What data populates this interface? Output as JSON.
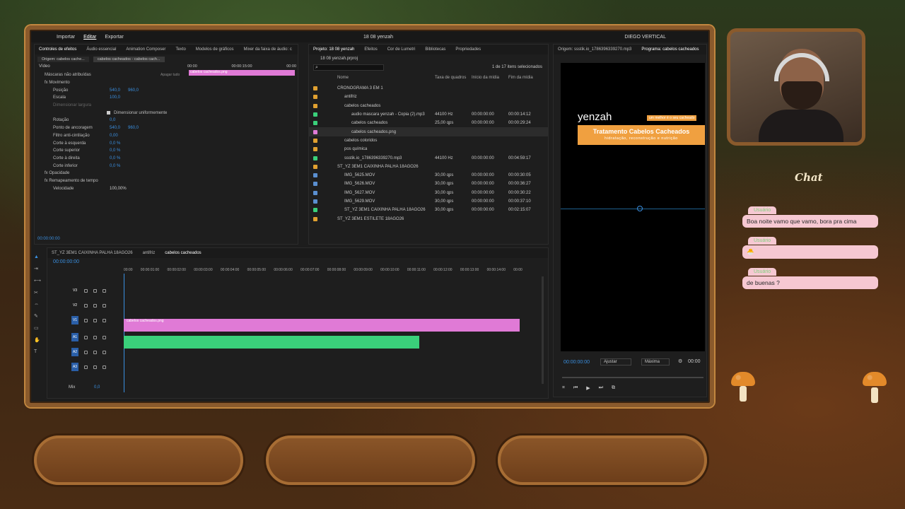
{
  "menu": {
    "items": [
      "Importar",
      "Editar",
      "Exportar"
    ],
    "project_title": "18 08 yenzah",
    "workspace": "DIEGO VERTICAL"
  },
  "effects_panel": {
    "tabs": [
      "Controles de efeitos",
      "Áudio essencial",
      "Animation Composer",
      "Texto",
      "Modelos de gráficos",
      "Mixer da faixa de áudio: c"
    ],
    "source_label": "Origem: cabelos cache...",
    "clip_label": "cabelos cacheados - cabelos cach...",
    "clip_name": "cabelos cacheados.png",
    "section_video": "Vídeo",
    "ruler": [
      "00:00",
      "00:00:15:00",
      "00:00"
    ],
    "rows": [
      {
        "label": "Máscaras não atribuídas",
        "value": "Apagar tudo"
      },
      {
        "label": "fx Movimento",
        "value": ""
      },
      {
        "label": "Posição",
        "value": "540,0",
        "value2": "960,0"
      },
      {
        "label": "Escala",
        "value": "100,0",
        "value2": ""
      },
      {
        "label": "Dimensionar largura",
        "value": "",
        "value2": ""
      },
      {
        "label": "Dimensionar uniformemente",
        "value": "",
        "value2": ""
      },
      {
        "label": "Rotação",
        "value": "0,0",
        "value2": ""
      },
      {
        "label": "Ponto de ancoragem",
        "value": "540,0",
        "value2": "960,0"
      },
      {
        "label": "Filtro anti-cintilação",
        "value": "0,00",
        "value2": ""
      },
      {
        "label": "Corte à esquerda",
        "value": "0,0 %",
        "value2": ""
      },
      {
        "label": "Corte superior",
        "value": "0,0 %",
        "value2": ""
      },
      {
        "label": "Corte à direita",
        "value": "0,0 %",
        "value2": ""
      },
      {
        "label": "Corte inferior",
        "value": "0,0 %",
        "value2": ""
      },
      {
        "label": "fx Opacidade",
        "value": "",
        "value2": ""
      },
      {
        "label": "fx Remapeamento de tempo",
        "value": "",
        "value2": ""
      },
      {
        "label": "Velocidade",
        "value": "100,00%",
        "value2": ""
      }
    ],
    "timecode": "00:00:00:00"
  },
  "project_panel": {
    "tabs": [
      "Projeto: 18 08 yenzah",
      "Efeitos",
      "Cor de Lumetri",
      "Bibliotecas",
      "Propriedades"
    ],
    "file": "18 08 yenzah.prproj",
    "selection": "1 de 17 itens selecionados",
    "headers": [
      "Nome",
      "Taxa de quadros",
      "Início da mídia",
      "Fim da mídia"
    ],
    "items": [
      {
        "name": "CRONOGRAMA 3 EM 1",
        "rate": "",
        "start": "",
        "end": "",
        "color": "#e0a030"
      },
      {
        "name": "antifriz",
        "rate": "",
        "start": "",
        "end": "",
        "color": "#e0a030"
      },
      {
        "name": "cabelos cacheados",
        "rate": "",
        "start": "",
        "end": "",
        "color": "#e0a030"
      },
      {
        "name": "audio mascara yenzah - Copia (2).mp3",
        "rate": "44100 Hz",
        "start": "00:00:00:00",
        "end": "00:00:14:12",
        "color": "#3ad07a"
      },
      {
        "name": "cabelos cacheados",
        "rate": "25,00 qps",
        "start": "00:00:00:00",
        "end": "00:00:29:24",
        "color": "#3ad07a"
      },
      {
        "name": "cabelos cacheados.png",
        "rate": "",
        "start": "",
        "end": "",
        "color": "#e07ad6"
      },
      {
        "name": "cabelos coloridos",
        "rate": "",
        "start": "",
        "end": "",
        "color": "#e0a030"
      },
      {
        "name": "pos química",
        "rate": "",
        "start": "",
        "end": "",
        "color": "#e0a030"
      },
      {
        "name": "ssstik.io_1786396339270.mp3",
        "rate": "44100 Hz",
        "start": "00:00:00:00",
        "end": "00:04:59:17",
        "color": "#3ad07a"
      },
      {
        "name": "ST_YZ 3EM1 CAIXINHA PALHA 18AGO26",
        "rate": "",
        "start": "",
        "end": "",
        "color": "#e0a030"
      },
      {
        "name": "IMG_5625.MOV",
        "rate": "30,00 qps",
        "start": "00:00:00:00",
        "end": "00:00:30:05",
        "color": "#5a8fd0"
      },
      {
        "name": "IMG_5626.MOV",
        "rate": "30,00 qps",
        "start": "00:00:00:00",
        "end": "00:00:36:27",
        "color": "#5a8fd0"
      },
      {
        "name": "IMG_5627.MOV",
        "rate": "30,00 qps",
        "start": "00:00:00:00",
        "end": "00:00:30:22",
        "color": "#5a8fd0"
      },
      {
        "name": "IMG_5629.MOV",
        "rate": "30,00 qps",
        "start": "00:00:00:00",
        "end": "00:00:37:10",
        "color": "#5a8fd0"
      },
      {
        "name": "ST_YZ 3EM1 CAIXINHA PALHA 18AGO26",
        "rate": "30,00 qps",
        "start": "00:00:00:00",
        "end": "00:02:15:07",
        "color": "#3ad07a"
      },
      {
        "name": "ST_YZ 3EM1 ESTILETE 18AGO26",
        "rate": "",
        "start": "",
        "end": "",
        "color": "#e0a030"
      }
    ]
  },
  "program_monitor": {
    "tabs": [
      "Origem: ssstik.io_1786396339270.mp3",
      "Programa: cabelos cacheados"
    ],
    "brand": "yenzah",
    "title": "Tratamento Cabelos Cacheados",
    "subtitle": "hidratação, reconstrução e nutrição",
    "tag": "um melhor é o seu cacheado",
    "timecode": "00:00:00:00",
    "fit": "Ajustar",
    "quality": "Máxima",
    "timecode_right": "00:00"
  },
  "timeline": {
    "tabs": [
      "ST_YZ 3EM1 CAIXINHA PALHA 18AGO26",
      "antifriz",
      "cabelos cacheados"
    ],
    "timecode": "00:00:00:00",
    "ruler": [
      "00:00",
      "00:00:01:00",
      "00:00:02:00",
      "00:00:03:00",
      "00:00:04:00",
      "00:00:05:00",
      "00:00:06:00",
      "00:00:07:00",
      "00:00:08:00",
      "00:00:09:00",
      "00:00:10:00",
      "00:00:11:00",
      "00:00:12:00",
      "00:00:13:00",
      "00:00:14:00",
      "00:00"
    ],
    "tracks": [
      "V3",
      "V2",
      "V1",
      "A1",
      "A2",
      "A3"
    ],
    "mix_label": "Mix",
    "mix_value": "0,0",
    "clip_label": "cabelos cacheados.png"
  },
  "chat": {
    "title": "Chat",
    "messages": [
      {
        "user": "Usuário",
        "text": "Boa noite vamo que vamo, bora pra cima"
      },
      {
        "user": "Usuário",
        "text": "🐣"
      },
      {
        "user": "Usuário",
        "text": "de buenas ?"
      }
    ]
  },
  "colors": {
    "accent_blue": "#3a8fe0",
    "clip_pink": "#e07ad6",
    "audio_green": "#3ad07a",
    "banner_orange": "#f0a040",
    "frame_wood": "#8a5a2c"
  }
}
